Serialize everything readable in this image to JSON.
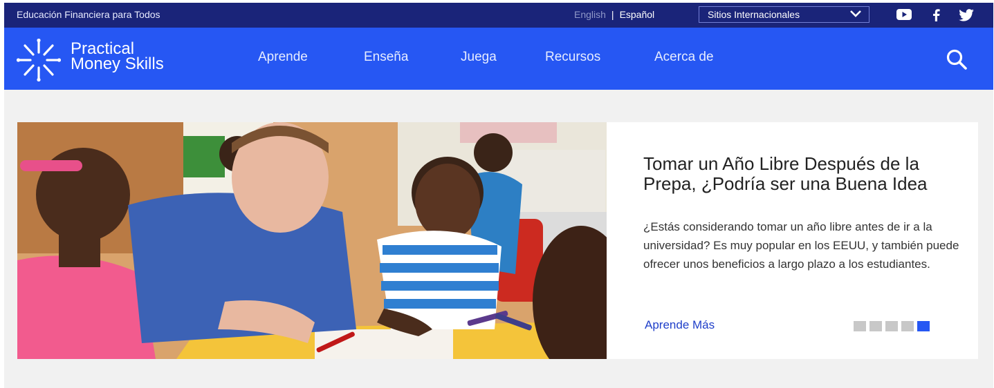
{
  "topbar": {
    "tagline": "Educación Financiera para Todos",
    "lang_english": "English",
    "lang_separator": "|",
    "lang_spanish": "Español",
    "intl_select": "Sitios Internacionales"
  },
  "social": [
    "youtube-icon",
    "facebook-icon",
    "twitter-icon"
  ],
  "logo": {
    "line1": "Practical",
    "line2": "Money Skills"
  },
  "nav": {
    "items": [
      "Aprende",
      "Enseña",
      "Juega",
      "Recursos",
      "Acerca de"
    ]
  },
  "hero": {
    "title": "Tomar un Año Libre Después de la Prepa, ¿Podría ser una Buena Idea",
    "body": "¿Estás considerando tomar un año libre antes de ir a la universidad? Es muy popular en los EEUU, y también puede ofrecer unos beneficios a largo plazo a los estudiantes.",
    "cta": "Aprende Más",
    "slides_total": 5,
    "slide_active": 5
  },
  "colors": {
    "topbar": "#1a2479",
    "nav": "#2657f3",
    "accent": "#2657f3",
    "link": "#1f3fc9"
  }
}
